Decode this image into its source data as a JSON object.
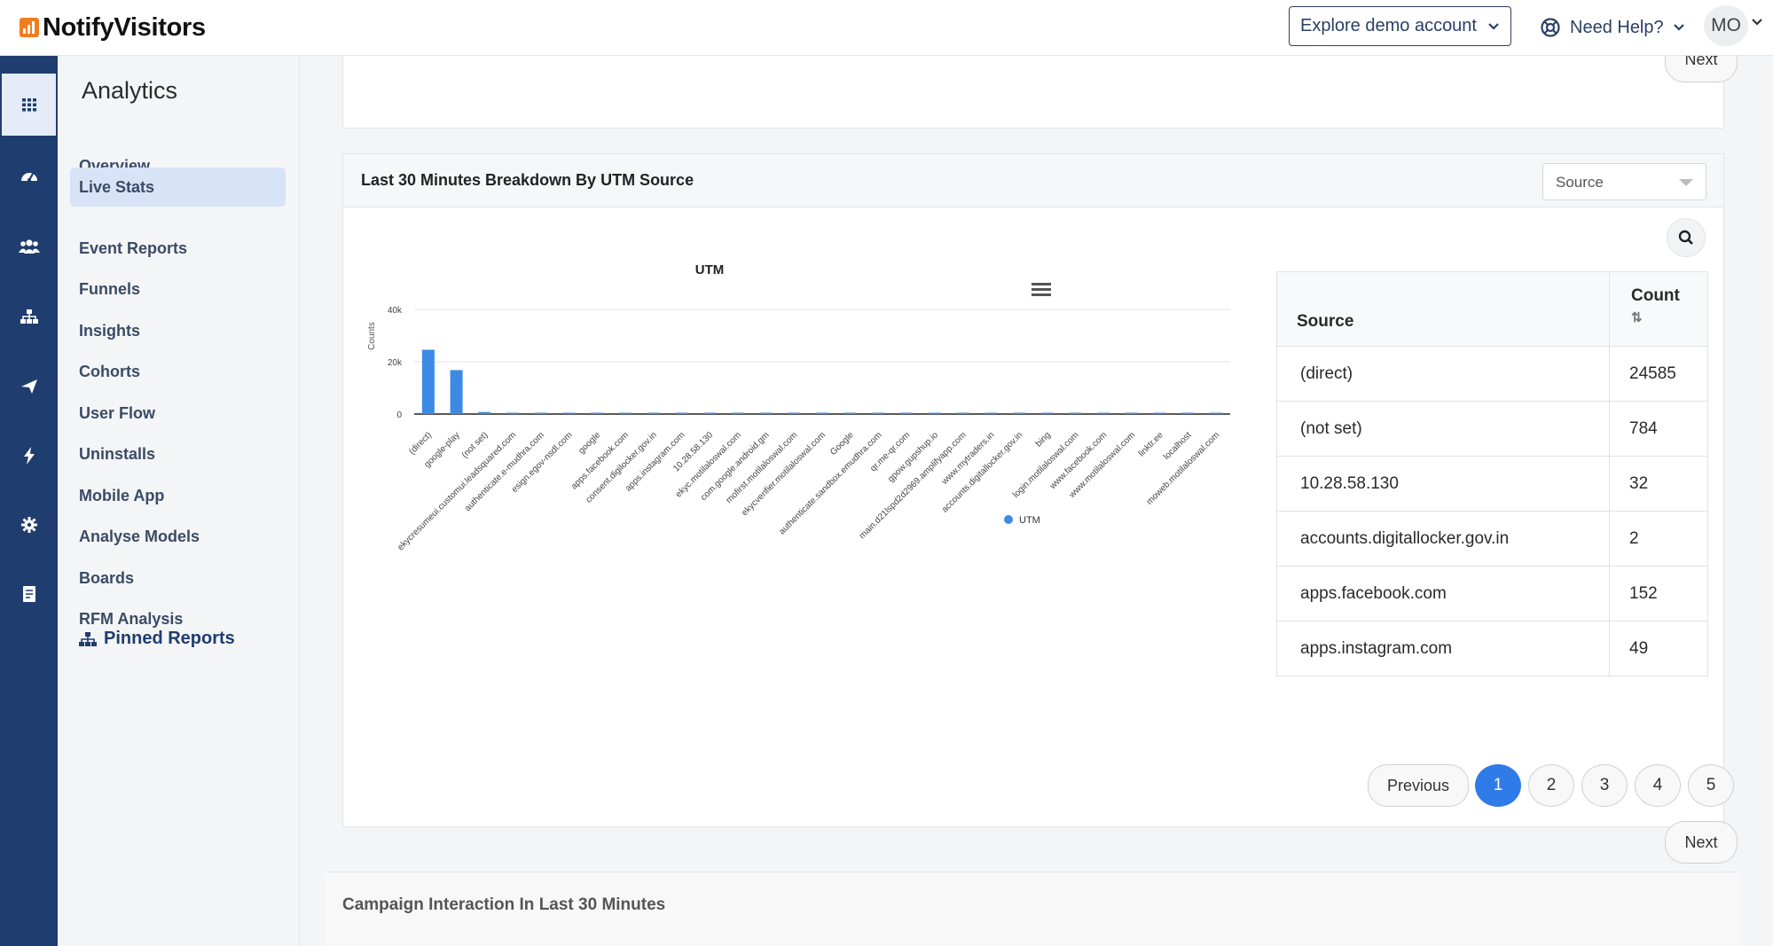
{
  "topbar": {
    "brand_bold": "Notify",
    "brand_rest": "Visitors",
    "demo_label": "Explore demo account",
    "help_label": "Need Help?",
    "avatar_initials": "MO"
  },
  "rail": {
    "items": [
      {
        "icon": "grid-icon",
        "active": true
      },
      {
        "icon": "dashboard-icon"
      },
      {
        "icon": "users-icon"
      },
      {
        "icon": "hierarchy-icon"
      },
      {
        "icon": "send-icon"
      },
      {
        "icon": "lightning-icon"
      },
      {
        "icon": "gear-icon"
      },
      {
        "icon": "document-icon"
      }
    ],
    "accent": "#1f3d6e"
  },
  "menu": {
    "title": "Analytics",
    "items": [
      {
        "label": "Overview"
      },
      {
        "label": "Live Stats",
        "active": true
      },
      {
        "label": "Event Reports"
      },
      {
        "label": "Funnels"
      },
      {
        "label": "Insights"
      },
      {
        "label": "Cohorts"
      },
      {
        "label": "User Flow"
      },
      {
        "label": "Uninstalls"
      },
      {
        "label": "Mobile App"
      },
      {
        "label": "Analyse Models"
      },
      {
        "label": "Boards"
      },
      {
        "label": "RFM Analysis"
      }
    ],
    "pinned_label": "Pinned Reports"
  },
  "previous_card": {
    "next_label": "Next"
  },
  "card": {
    "title": "Last 30 Minutes Breakdown By UTM Source",
    "select_value": "Source",
    "table": {
      "headers": {
        "source": "Source",
        "count": "Count",
        "sort_glyph": "⇅"
      },
      "rows": [
        {
          "source": "(direct)",
          "count": "24585"
        },
        {
          "source": "(not set)",
          "count": "784"
        },
        {
          "source": "10.28.58.130",
          "count": "32"
        },
        {
          "source": "accounts.digitallocker.gov.in",
          "count": "2"
        },
        {
          "source": "apps.facebook.com",
          "count": "152"
        },
        {
          "source": "apps.instagram.com",
          "count": "49"
        }
      ]
    },
    "pagination": {
      "previous_label": "Previous",
      "pages": [
        "1",
        "2",
        "3",
        "4",
        "5"
      ],
      "current": "1",
      "next_label": "Next"
    }
  },
  "bottom_card": {
    "title": "Campaign Interaction In Last 30 Minutes"
  },
  "chart_data": {
    "type": "bar",
    "title": "UTM",
    "ylabel": "Counts",
    "xlabel": "",
    "ylim": [
      0,
      40000
    ],
    "yticks": [
      "0",
      "20k",
      "40k"
    ],
    "legend": "bottom-right",
    "grid": true,
    "color": "#3b8be6",
    "categories": [
      "(direct)",
      "google-play",
      "(not set)",
      "ekycresumeui.customui.leadsquared.com",
      "authenticate.e-mudhra.com",
      "esign.egov-nsdl.com",
      "google",
      "apps.facebook.com",
      "consent.digilocker.gov.in",
      "apps.instagram.com",
      "10.28.58.130",
      "ekyc.motilaloswal.com",
      "com.google.android.gm",
      "mofirst.motilaloswal.com",
      "ekycverifier.motilaloswal.com",
      "Google",
      "authenticate.sandbox.emudhra.com",
      "qr.me-qr.com",
      "gpow.gupshup.io",
      "main.d21lspd2d2969.amplifyapp.com",
      "www.mytraders.in",
      "accounts.digitallocker.gov.in",
      "bing",
      "login.motilaloswal.com",
      "www.facebook.com",
      "www.motilaloswal.com",
      "linktr.ee",
      "localhost",
      "moweb.motilaloswal.com"
    ],
    "series": [
      {
        "name": "UTM",
        "values": [
          24585,
          16800,
          784,
          400,
          300,
          250,
          200,
          152,
          120,
          49,
          32,
          30,
          25,
          20,
          18,
          15,
          12,
          10,
          8,
          6,
          5,
          4,
          3,
          3,
          2,
          2,
          2,
          1,
          1
        ]
      }
    ]
  }
}
